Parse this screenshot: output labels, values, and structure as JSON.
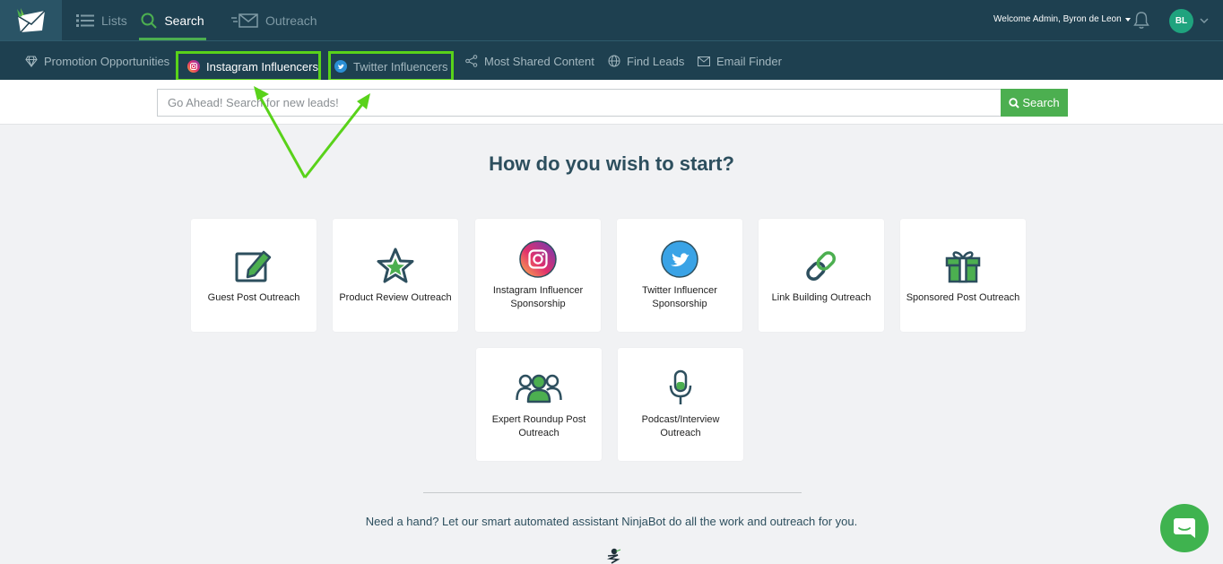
{
  "topnav": {
    "items": [
      {
        "label": "Lists",
        "icon": "list-icon"
      },
      {
        "label": "Search",
        "icon": "search-icon",
        "active": true
      },
      {
        "label": "Outreach",
        "icon": "send-mail-icon"
      }
    ],
    "welcome": "Welcome Admin, Byron de Leon",
    "avatar_initials": "BL"
  },
  "subnav": {
    "items": [
      {
        "label": "Promotion Opportunities",
        "icon": "diamond-icon"
      },
      {
        "label": "Instagram Influencers",
        "icon": "instagram-icon",
        "highlighted": true
      },
      {
        "label": "Twitter Influencers",
        "icon": "twitter-icon",
        "highlighted": true
      },
      {
        "label": "Most Shared Content",
        "icon": "share-icon"
      },
      {
        "label": "Find Leads",
        "icon": "globe-icon"
      },
      {
        "label": "Email Finder",
        "icon": "envelope-icon"
      }
    ]
  },
  "search": {
    "placeholder": "Go Ahead! Search for new leads!",
    "button_label": "Search"
  },
  "heading": "How do you wish to start?",
  "cards": [
    {
      "label": "Guest Post Outreach",
      "icon": "edit-icon"
    },
    {
      "label": "Product Review Outreach",
      "icon": "star-icon"
    },
    {
      "label": "Instagram Influencer Sponsorship",
      "icon": "instagram-icon"
    },
    {
      "label": "Twitter Influencer Sponsorship",
      "icon": "twitter-icon"
    },
    {
      "label": "Link Building Outreach",
      "icon": "link-icon"
    },
    {
      "label": "Sponsored Post Outreach",
      "icon": "gift-icon"
    },
    {
      "label": "Expert Roundup Post Outreach",
      "icon": "group-icon"
    },
    {
      "label": "Podcast/Interview Outreach",
      "icon": "microphone-icon"
    }
  ],
  "help_text": "Need a hand? Let our smart automated assistant NinjaBot do all the work and outreach for you.",
  "colors": {
    "nav_bg": "#1e4050",
    "accent_green": "#4caf50",
    "highlight_green": "#59d21a",
    "heading": "#2d4f5e"
  }
}
